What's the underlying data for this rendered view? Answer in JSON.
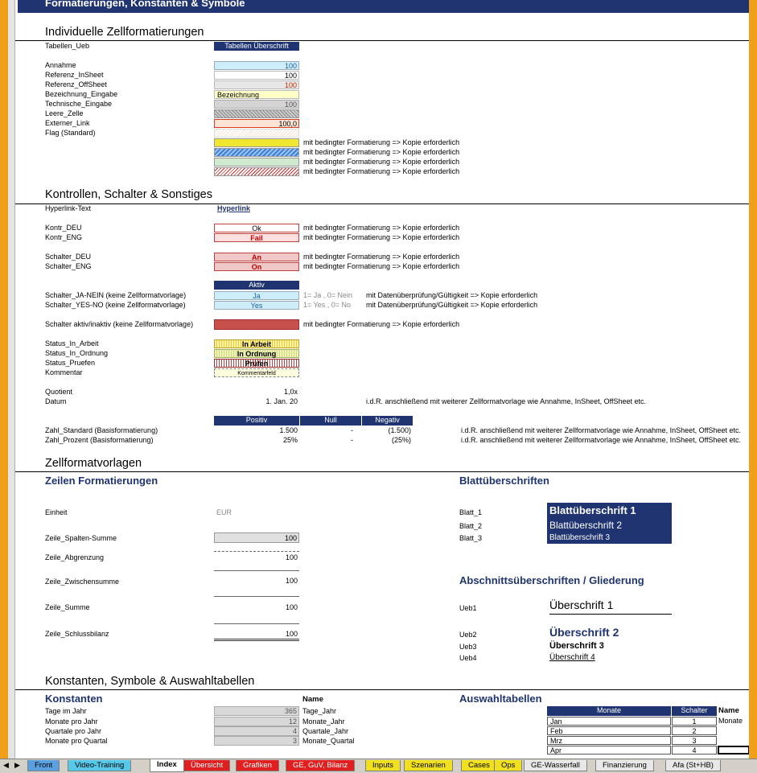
{
  "title_bar": "Formatierungen, Konstanten & Symbole",
  "colors": {
    "navy": "#1f3470",
    "tab_orange": "#f0a018"
  },
  "s1": {
    "title": "Individuelle Zellformatierungen",
    "tab_ueb": {
      "label": "Tabellen_Ueb",
      "value": "Tabellen Überschrift"
    },
    "rows": [
      {
        "label": "Annahme",
        "value": "100"
      },
      {
        "label": "Referenz_InSheet",
        "value": "100"
      },
      {
        "label": "Referenz_OffSheet",
        "value": "100"
      },
      {
        "label": "Bezeichnung_Eingabe",
        "value": "Bezeichnung"
      },
      {
        "label": "Technische_Eingabe",
        "value": "100"
      },
      {
        "label": "Leere_Zelle",
        "value": ""
      },
      {
        "label": "Externer_Link",
        "value": "100,0"
      },
      {
        "label": "Flag (Standard)",
        "value": ""
      }
    ],
    "cond_note": "mit bedingter Formatierung => Kopie erforderlich"
  },
  "s2": {
    "title": "Kontrollen, Schalter & Sonstiges",
    "hyperlink_label": "Hyperlink-Text",
    "hyperlink_value": "Hyperlink",
    "kontr_deu": {
      "label": "Kontr_DEU",
      "value": "Ok"
    },
    "kontr_eng": {
      "label": "Kontr_ENG",
      "value": "Fail"
    },
    "schalter_deu": {
      "label": "Schalter_DEU",
      "value": "An"
    },
    "schalter_eng": {
      "label": "Schalter_ENG",
      "value": "On"
    },
    "aktiv": "Aktiv",
    "ja_nein": {
      "label": "Schalter_JA-NEIN (keine Zellformatvorlage)",
      "value": "Ja",
      "hint": "1= Ja , 0= Nein"
    },
    "yes_no": {
      "label": "Schalter_YES-NO (keine Zellformatvorlage)",
      "value": "Yes",
      "hint": "1= Yes , 0= No"
    },
    "dv_note": "mit Datenüberprüfung/Gültigkeit => Kopie erforderlich",
    "aktiv_inaktiv": {
      "label": "Schalter aktiv/inaktiv (keine Zellformatvorlage)"
    },
    "status_arbeit": {
      "label": "Status_In_Arbeit",
      "value": "In Arbeit"
    },
    "status_ordnung": {
      "label": "Status_In_Ordnung",
      "value": "In Ordnung"
    },
    "status_pruefen": {
      "label": "Status_Pruefen",
      "value": "Prüfen"
    },
    "kommentar": {
      "label": "Kommentar",
      "value": "Kommentarfeld"
    },
    "quotient": {
      "label": "Quotient",
      "value": "1,0x"
    },
    "datum": {
      "label": "Datum",
      "value": "1. Jan. 20",
      "note": "i.d.R. anschließend mit weiterer Zellformatvorlage wie Annahme, InSheet, OffSheet etc."
    },
    "headers": [
      "Positiv",
      "Null",
      "Negativ"
    ],
    "zahl_standard": {
      "label": "Zahl_Standard (Basisformatierung)",
      "pos": "1.500",
      "null": "-",
      "neg": "(1.500)"
    },
    "zahl_prozent": {
      "label": "Zahl_Prozent (Basisformatierung)",
      "pos": "25%",
      "null": "-",
      "neg": "(25%)"
    },
    "zahl_note": "i.d.R. anschließend mit weiterer Zellformatvorlage wie Annahme, InSheet, OffSheet etc."
  },
  "s3": {
    "title": "Zellformatvorlagen",
    "zeilen_title": "Zeilen Formatierungen",
    "einheit": {
      "label": "Einheit",
      "value": "EUR"
    },
    "rows": [
      {
        "label": "Zeile_Spalten-Summe",
        "value": "100"
      },
      {
        "label": "Zeile_Abgrenzung",
        "value": "100"
      },
      {
        "label": "Zeile_Zwischensumme",
        "value": "100"
      },
      {
        "label": "Zeile_Summe",
        "value": "100"
      },
      {
        "label": "Zeile_Schlussbilanz",
        "value": "100"
      }
    ],
    "blatt_title": "Blattüberschriften",
    "blatt_labels": [
      "Blatt_1",
      "Blatt_2",
      "Blatt_3"
    ],
    "blatt_values": [
      "Blattüberschrift 1",
      "Blattüberschrift 2",
      "Blattüberschrift 3"
    ],
    "abschnitt_title": "Abschnittsüberschriften / Gliederung",
    "ueb_labels": [
      "Ueb1",
      "Ueb2",
      "Ueb3",
      "Ueb4"
    ],
    "ueb_values": [
      "Überschrift 1",
      "Überschrift 2",
      "Überschrift 3",
      "Überschrift 4"
    ]
  },
  "s4": {
    "title": "Konstanten, Symbole & Auswahltabellen",
    "konst_title": "Konstanten",
    "name_header": "Name",
    "konst": [
      {
        "label": "Tage im Jahr",
        "value": "365",
        "name": "Tage_Jahr"
      },
      {
        "label": "Monate pro Jahr",
        "value": "12",
        "name": "Monate_Jahr"
      },
      {
        "label": "Quartale pro Jahr",
        "value": "4",
        "name": "Quartale_Jahr"
      },
      {
        "label": "Monate pro Quartal",
        "value": "3",
        "name": "Monate_Quartal"
      }
    ],
    "auswahl_title": "Auswahltabellen",
    "auswahl_headers": [
      "Monate",
      "Schalter"
    ],
    "auswahl_rows": [
      [
        "Jan",
        "1"
      ],
      [
        "Feb",
        "2"
      ],
      [
        "Mrz",
        "3"
      ],
      [
        "Apr",
        "4"
      ]
    ],
    "auswahl_name_header": "Name",
    "auswahl_name": "Monate"
  },
  "tabs": [
    "Front",
    "Video-Training",
    "Index",
    "Übersicht",
    "Grafiken",
    "GE, GuV, Bilanz",
    "Inputs",
    "Szenarien",
    "Cases",
    "Ops",
    "GE-Wasserfall",
    "Finanzierung",
    "Afa (St+HB)"
  ]
}
